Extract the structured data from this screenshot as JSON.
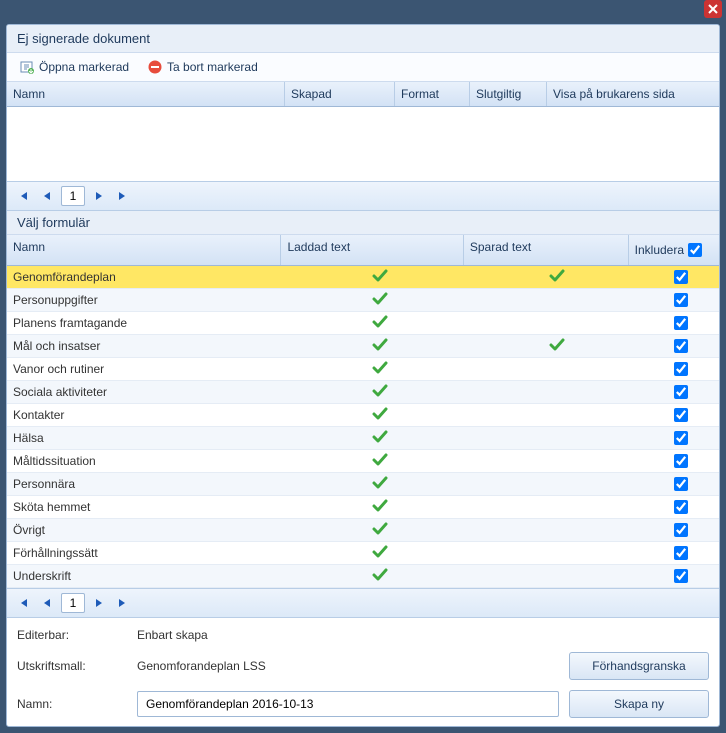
{
  "window": {
    "close": "×"
  },
  "panel1": {
    "title": "Ej signerade dokument",
    "toolbar": {
      "open": "Öppna markerad",
      "delete": "Ta bort markerad"
    },
    "columns": {
      "name": "Namn",
      "created": "Skapad",
      "format": "Format",
      "final": "Slutgiltig",
      "show": "Visa på brukarens sida"
    },
    "pager": {
      "page": "1"
    }
  },
  "panel2": {
    "title": "Välj formulär",
    "columns": {
      "name": "Namn",
      "loaded": "Laddad text",
      "saved": "Sparad text",
      "include": "Inkludera"
    },
    "rows": [
      {
        "name": "Genomförandeplan",
        "loaded": true,
        "saved": true,
        "include": true,
        "hl": true
      },
      {
        "name": "Personuppgifter",
        "loaded": true,
        "saved": false,
        "include": true
      },
      {
        "name": "Planens framtagande",
        "loaded": true,
        "saved": false,
        "include": true
      },
      {
        "name": "Mål och insatser",
        "loaded": true,
        "saved": true,
        "include": true
      },
      {
        "name": "Vanor och rutiner",
        "loaded": true,
        "saved": false,
        "include": true
      },
      {
        "name": "Sociala aktiviteter",
        "loaded": true,
        "saved": false,
        "include": true
      },
      {
        "name": "Kontakter",
        "loaded": true,
        "saved": false,
        "include": true
      },
      {
        "name": "Hälsa",
        "loaded": true,
        "saved": false,
        "include": true
      },
      {
        "name": "Måltidssituation",
        "loaded": true,
        "saved": false,
        "include": true
      },
      {
        "name": "Personnära",
        "loaded": true,
        "saved": false,
        "include": true
      },
      {
        "name": "Sköta hemmet",
        "loaded": true,
        "saved": false,
        "include": true
      },
      {
        "name": "Övrigt",
        "loaded": true,
        "saved": false,
        "include": true
      },
      {
        "name": "Förhållningssätt",
        "loaded": true,
        "saved": false,
        "include": true
      },
      {
        "name": "Underskrift",
        "loaded": true,
        "saved": false,
        "include": true
      }
    ],
    "pager": {
      "page": "1"
    }
  },
  "footer": {
    "editable_label": "Editerbar:",
    "editable_value": "Enbart skapa",
    "template_label": "Utskriftsmall:",
    "template_value": "Genomforandeplan LSS",
    "name_label": "Namn:",
    "name_value": "Genomförandeplan 2016-10-13",
    "preview_btn": "Förhandsgranska",
    "create_btn": "Skapa ny"
  }
}
